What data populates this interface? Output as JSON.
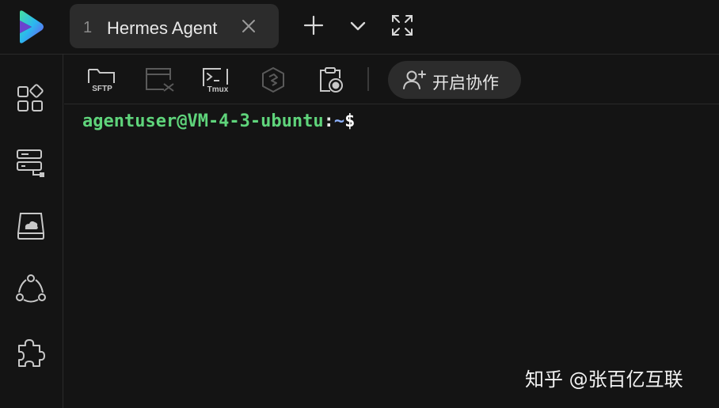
{
  "titlebar": {
    "tab": {
      "number": "1",
      "title": "Hermes Agent"
    },
    "buttons": [
      "new-tab",
      "tab-menu",
      "fullscreen"
    ]
  },
  "toolbar": {
    "sftp_label": "SFTP",
    "tmux_label": "Tmux",
    "collab_label": "开启协作"
  },
  "terminal": {
    "user_host": "agentuser@VM-4-3-ubuntu",
    "colon": ":",
    "path": "~",
    "dollar": "$"
  },
  "watermark": "知乎 @张百亿互联",
  "colors": {
    "background": "#141414",
    "tab": "#2c2c2c",
    "prompt_user": "#5fd47b",
    "prompt_path": "#8fb3ff",
    "icon": "#c8c8c8"
  },
  "icons": {
    "rail": [
      "apps-icon",
      "server-list-icon",
      "cloud-drive-icon",
      "network-icon",
      "plugin-icon"
    ],
    "toolbar": [
      "sftp-folder-icon",
      "vscode-window-icon",
      "tmux-terminal-icon",
      "hexagon-tool-icon",
      "screenshot-clipboard-icon",
      "add-user-icon"
    ]
  }
}
